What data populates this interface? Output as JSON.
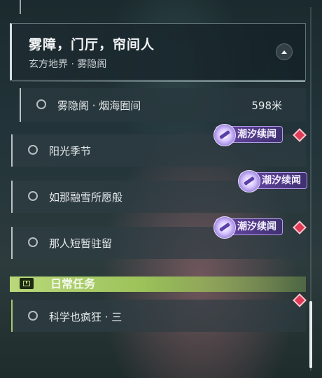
{
  "header": {
    "title": "雾障，门厅，帘间人",
    "subtitle": "玄方地界 · 雾隐阁"
  },
  "active_objective": {
    "label": "雾隐阁 · 烟海囿间",
    "distance": "598米"
  },
  "quests": [
    {
      "label": "阳光季节"
    },
    {
      "label": "如那融雪所愿般"
    },
    {
      "label": "那人短暂驻留"
    }
  ],
  "badges": {
    "tide_label": "潮汐续闻"
  },
  "daily_section": {
    "title": "日常任务",
    "quests": [
      {
        "label": "科学也疯狂 · 三"
      }
    ]
  },
  "colors": {
    "tide_badge": "#6a4aa8",
    "tracked_marker": "#e03a55",
    "daily_accent": "#b9d97a"
  }
}
